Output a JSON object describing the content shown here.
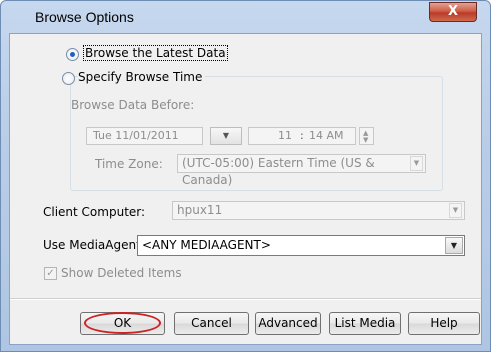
{
  "window": {
    "title": "Browse Options",
    "close_glyph": "X"
  },
  "browse_latest": {
    "label": "Browse the Latest Data",
    "checked": true
  },
  "specify_time": {
    "label": "Specify Browse Time",
    "checked": false,
    "browse_before_label": "Browse Data Before:",
    "date_value": "Tue 11/01/2011",
    "time_hour": "11",
    "time_sep": ":",
    "time_rest": "14 AM",
    "timezone_label": "Time Zone:",
    "timezone_value": "(UTC-05:00) Eastern Time (US & Canada)"
  },
  "client_computer": {
    "label": "Client Computer:",
    "value": "hpux11"
  },
  "media_agent": {
    "label": "Use MediaAgent",
    "value": "<ANY MEDIAAGENT>"
  },
  "show_deleted": {
    "label": "Show Deleted Items",
    "checked": true
  },
  "buttons": {
    "ok": "OK",
    "cancel": "Cancel",
    "advanced": "Advanced",
    "list_media": "List Media",
    "help": "Help"
  },
  "icons": {
    "dropdown": "chevron-down-icon",
    "check": "check-icon",
    "spinner": "spin-arrows-icon"
  },
  "colors": {
    "title_bar": "#b9cde8",
    "close_button": "#c64b35",
    "highlight_ring": "#cc2222",
    "radio_dot": "#1f5fbf"
  }
}
